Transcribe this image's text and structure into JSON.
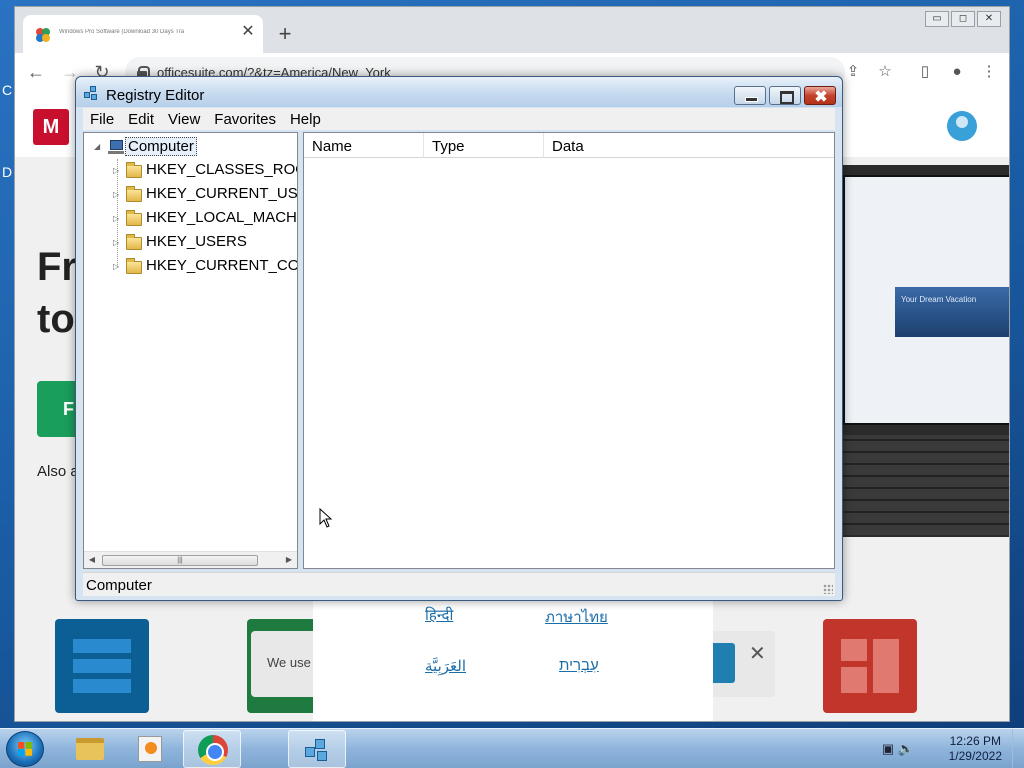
{
  "desktop": {
    "edge_chars": [
      "C",
      "D"
    ]
  },
  "browser": {
    "tab_title": "Windows Pro Software (Download 30 Days Tra",
    "tab_close": "✕",
    "new_tab": "+",
    "url": "officesuite.com/?&tz=America/New_York",
    "window_controls": [
      "▭",
      "◻",
      "✕"
    ],
    "page": {
      "logo_text": "M",
      "hero_line1": "Fr",
      "hero_line2": "to",
      "cta_label": "Fi",
      "also_text": "Also a",
      "vacation_text": "Your Dream Vacation",
      "cookie_text": "We use",
      "cookie_close": "✕",
      "languages": [
        "हिन्दी",
        "ภาษาไทย",
        "العَرَبِيَّة",
        "עִבְרִית"
      ]
    }
  },
  "regedit": {
    "title": "Registry Editor",
    "menu": [
      "File",
      "Edit",
      "View",
      "Favorites",
      "Help"
    ],
    "tree": {
      "root": "Computer",
      "items": [
        "HKEY_CLASSES_ROOT",
        "HKEY_CURRENT_USER",
        "HKEY_LOCAL_MACHINE",
        "HKEY_USERS",
        "HKEY_CURRENT_CONFIG"
      ]
    },
    "columns": [
      "Name",
      "Type",
      "Data"
    ],
    "status": "Computer",
    "scroll_thumb_grip": "|||"
  },
  "taskbar": {
    "clock_time": "12:26 PM",
    "clock_date": "1/29/2022",
    "tray_icons": [
      "network-icon",
      "volume-icon"
    ]
  }
}
